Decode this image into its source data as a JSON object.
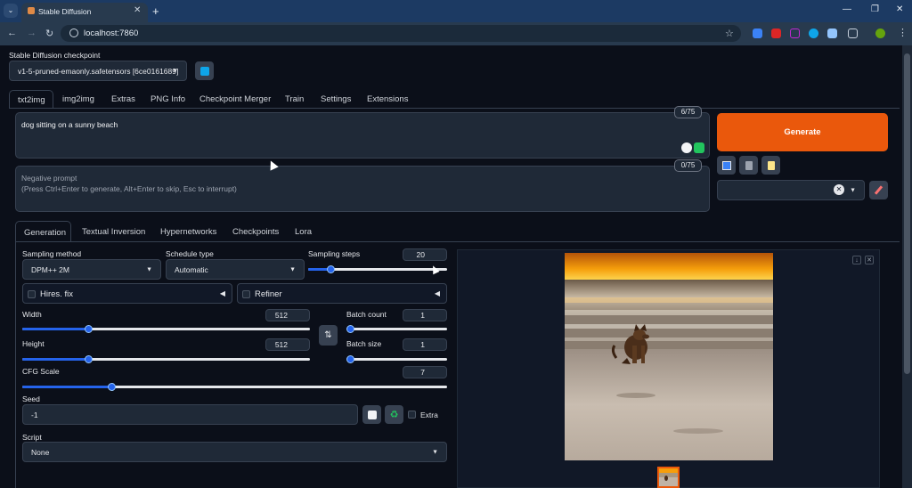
{
  "browser": {
    "tab_title": "Stable Diffusion",
    "url": "localhost:7860",
    "colors": {
      "tabbar": "#1c3a63",
      "toolbar": "#283a4e"
    }
  },
  "checkpoint": {
    "label": "Stable Diffusion checkpoint",
    "value": "v1-5-pruned-emaonly.safetensors [6ce0161689]"
  },
  "main_tabs": [
    "txt2img",
    "img2img",
    "Extras",
    "PNG Info",
    "Checkpoint Merger",
    "Train",
    "Settings",
    "Extensions"
  ],
  "prompt": {
    "value": "dog sitting on a sunny beach",
    "counter": "6/75"
  },
  "negative_prompt": {
    "placeholder_line1": "Negative prompt",
    "placeholder_line2": "(Press Ctrl+Enter to generate, Alt+Enter to skip, Esc to interrupt)",
    "counter": "0/75"
  },
  "generate": {
    "label": "Generate",
    "color": "#ea580c"
  },
  "sub_tabs": [
    "Generation",
    "Textual Inversion",
    "Hypernetworks",
    "Checkpoints",
    "Lora"
  ],
  "generation": {
    "sampling_method": {
      "label": "Sampling method",
      "value": "DPM++ 2M"
    },
    "schedule_type": {
      "label": "Schedule type",
      "value": "Automatic"
    },
    "sampling_steps": {
      "label": "Sampling steps",
      "value": "20",
      "fraction": 0.16
    },
    "hires_fix": {
      "label": "Hires. fix"
    },
    "refiner": {
      "label": "Refiner"
    },
    "width": {
      "label": "Width",
      "value": "512",
      "fraction": 0.23
    },
    "height": {
      "label": "Height",
      "value": "512",
      "fraction": 0.23
    },
    "batch_count": {
      "label": "Batch count",
      "value": "1",
      "fraction": 0.0
    },
    "batch_size": {
      "label": "Batch size",
      "value": "1",
      "fraction": 0.0
    },
    "cfg_scale": {
      "label": "CFG Scale",
      "value": "7",
      "fraction": 0.21
    },
    "seed": {
      "label": "Seed",
      "value": "-1",
      "extra_label": "Extra"
    },
    "script": {
      "label": "Script",
      "value": "None"
    }
  }
}
